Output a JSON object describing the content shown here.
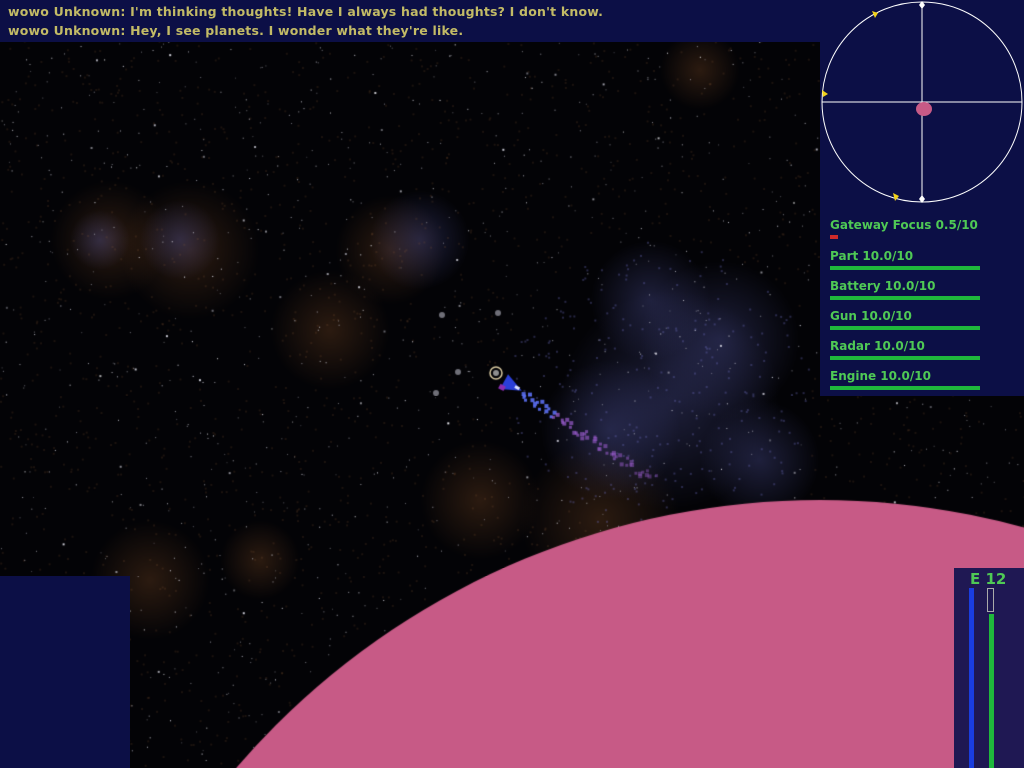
{
  "messages": [
    "wowo Unknown: I'm thinking thoughts! Have I always had thoughts? I don't know.",
    "wowo Unknown: Hey, I see planets. I wonder what they're like."
  ],
  "status": [
    {
      "label": "Gateway Focus 0.5/10",
      "value": 0.5,
      "max": 10,
      "color": "#d02a2a"
    },
    {
      "label": "Part 10.0/10",
      "value": 10,
      "max": 10,
      "color": "#1fb83c"
    },
    {
      "label": "Battery 10.0/10",
      "value": 10,
      "max": 10,
      "color": "#1fb83c"
    },
    {
      "label": "Gun 10.0/10",
      "value": 10,
      "max": 10,
      "color": "#1fb83c"
    },
    {
      "label": "Radar 10.0/10",
      "value": 10,
      "max": 10,
      "color": "#1fb83c"
    },
    {
      "label": "Engine 10.0/10",
      "value": 10,
      "max": 10,
      "color": "#1fb83c"
    }
  ],
  "energy": {
    "label": "E 12",
    "blue_fraction": 0.9,
    "green_fraction": 0.77
  },
  "colors": {
    "hud_panel": "#0c0f46",
    "planet": "#c75a86",
    "text_green": "#4fc955",
    "text_yellow": "#c3bb66"
  }
}
